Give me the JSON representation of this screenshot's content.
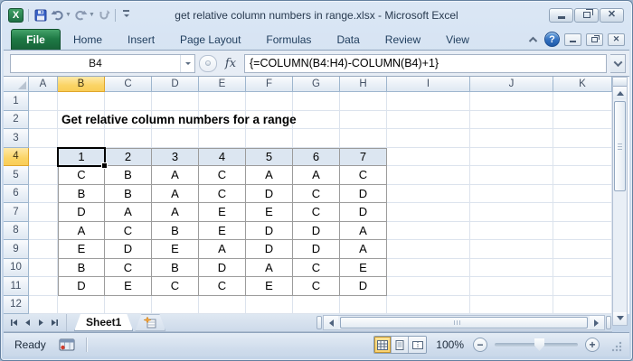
{
  "window": {
    "title": "get relative column numbers in range.xlsx  -  Microsoft Excel",
    "controls": [
      "minimize",
      "restore",
      "close"
    ]
  },
  "qat": {
    "icons": [
      "excel-logo",
      "save",
      "undo",
      "redo",
      "repeat",
      "customize-quick-access"
    ]
  },
  "ribbon": {
    "tabs": [
      "File",
      "Home",
      "Insert",
      "Page Layout",
      "Formulas",
      "Data",
      "Review",
      "View"
    ],
    "right_icons": [
      "minimize-ribbon",
      "help",
      "minimize-workbook",
      "restore-workbook",
      "close-workbook"
    ]
  },
  "formula_bar": {
    "name_box": "B4",
    "fx_label": "fx",
    "formula": "{=COLUMN(B4:H4)-COLUMN(B4)+1}"
  },
  "sheet": {
    "column_headers": [
      "A",
      "B",
      "C",
      "D",
      "E",
      "F",
      "G",
      "H",
      "I",
      "J",
      "K"
    ],
    "row_headers": [
      "1",
      "2",
      "3",
      "4",
      "5",
      "6",
      "7",
      "8",
      "9",
      "10",
      "11",
      "12"
    ],
    "selected_cell": "B4",
    "selected_column": "B",
    "selected_row": "4",
    "title_text": "Get relative column numbers for a range",
    "table": {
      "range": "B4:H11",
      "header_row": [
        "1",
        "2",
        "3",
        "4",
        "5",
        "6",
        "7"
      ],
      "rows": [
        [
          "C",
          "B",
          "A",
          "C",
          "A",
          "A",
          "C"
        ],
        [
          "B",
          "B",
          "A",
          "C",
          "D",
          "C",
          "D"
        ],
        [
          "D",
          "A",
          "A",
          "E",
          "E",
          "C",
          "D"
        ],
        [
          "A",
          "C",
          "B",
          "E",
          "D",
          "D",
          "A"
        ],
        [
          "E",
          "D",
          "E",
          "A",
          "D",
          "D",
          "A"
        ],
        [
          "B",
          "C",
          "B",
          "D",
          "A",
          "C",
          "E"
        ],
        [
          "D",
          "E",
          "C",
          "C",
          "E",
          "C",
          "D"
        ]
      ]
    }
  },
  "sheet_tabs": {
    "active": "Sheet1",
    "nav_icons": [
      "first-sheet",
      "previous-sheet",
      "next-sheet",
      "last-sheet"
    ],
    "insert_icon": "insert-worksheet"
  },
  "status_bar": {
    "mode": "Ready",
    "zoom": "100%",
    "view_icons": [
      "normal-view",
      "page-layout-view",
      "page-break-preview"
    ]
  },
  "colors": {
    "file_tab_green": "#1e7a45",
    "help_blue": "#2e6cbd",
    "selection_fill": "#dce6f1",
    "header_highlight": "#fbd465",
    "table_border": "#9c9c9c"
  }
}
